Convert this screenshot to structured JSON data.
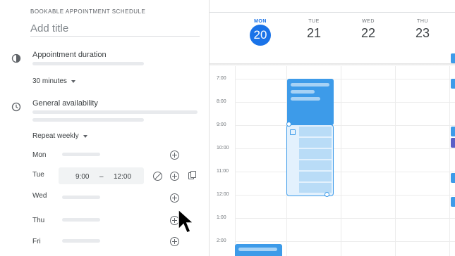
{
  "schedule": {
    "section_label": "BOOKABLE APPOINTMENT SCHEDULE",
    "title_placeholder": "Add title"
  },
  "appointment_duration": {
    "title": "Appointment duration",
    "icon": "duration-icon",
    "selected": "30 minutes"
  },
  "general_availability": {
    "title": "General availability",
    "icon": "clock-icon",
    "repeat": "Repeat weekly"
  },
  "days": [
    {
      "label": "Mon"
    },
    {
      "label": "Tue",
      "start": "9:00",
      "separator": "–",
      "end": "12:00"
    },
    {
      "label": "Wed"
    },
    {
      "label": "Thu"
    },
    {
      "label": "Fri"
    }
  ],
  "calendar": {
    "columns": [
      {
        "dow": "MON",
        "num": "20",
        "today": true
      },
      {
        "dow": "TUE",
        "num": "21"
      },
      {
        "dow": "WED",
        "num": "22"
      },
      {
        "dow": "THU",
        "num": "23"
      }
    ],
    "times": [
      "7:00",
      "8:00",
      "9:00",
      "10:00",
      "11:00",
      "12:00",
      "1:00",
      "2:00"
    ],
    "colors": {
      "accent": "#1a73e8",
      "event": "#3d9be9",
      "event_light": "#e3f1fd",
      "slot": "#b9dcf7",
      "purple_event": "#5b5fc7"
    }
  }
}
